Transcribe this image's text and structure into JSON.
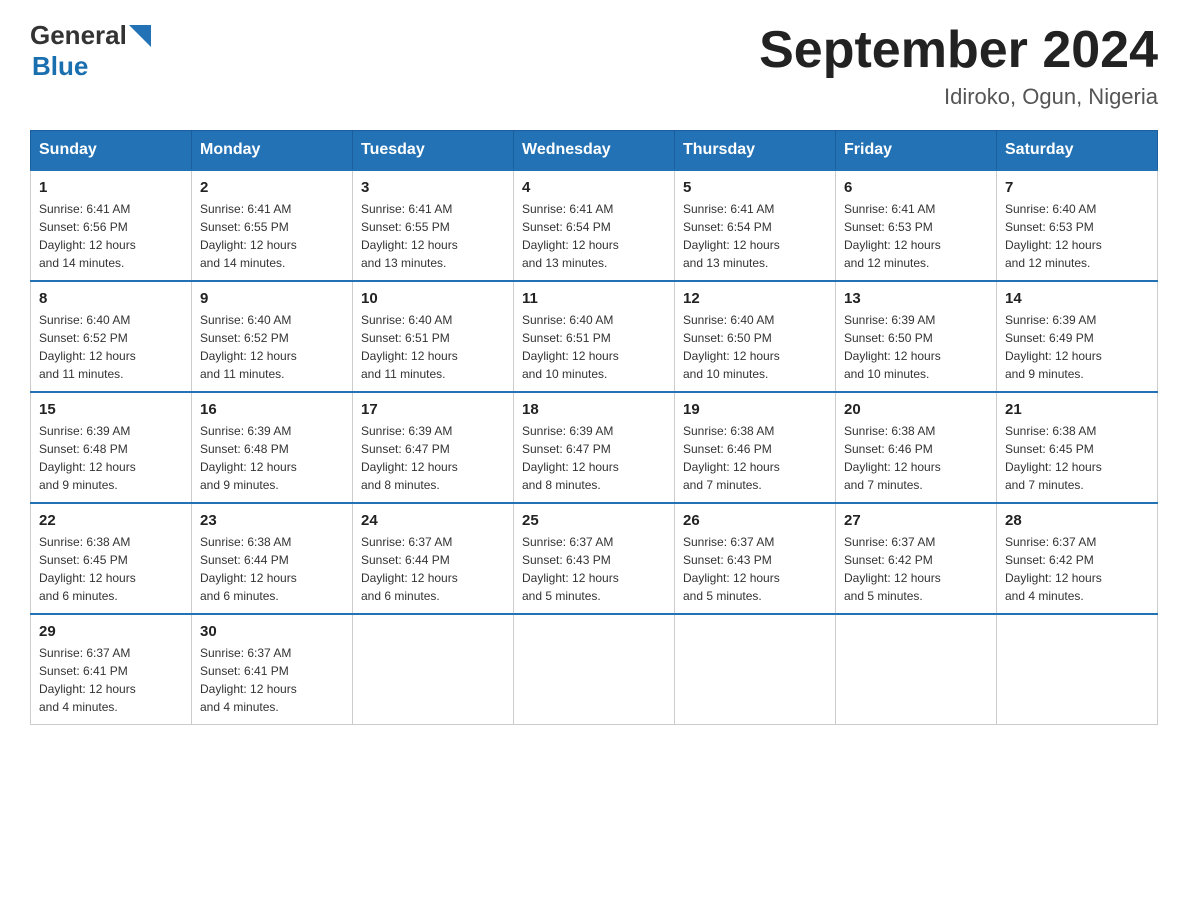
{
  "header": {
    "logo_general": "General",
    "logo_blue": "Blue",
    "title": "September 2024",
    "subtitle": "Idiroko, Ogun, Nigeria"
  },
  "days_of_week": [
    "Sunday",
    "Monday",
    "Tuesday",
    "Wednesday",
    "Thursday",
    "Friday",
    "Saturday"
  ],
  "weeks": [
    [
      {
        "day": "1",
        "sunrise": "6:41 AM",
        "sunset": "6:56 PM",
        "daylight": "12 hours and 14 minutes."
      },
      {
        "day": "2",
        "sunrise": "6:41 AM",
        "sunset": "6:55 PM",
        "daylight": "12 hours and 14 minutes."
      },
      {
        "day": "3",
        "sunrise": "6:41 AM",
        "sunset": "6:55 PM",
        "daylight": "12 hours and 13 minutes."
      },
      {
        "day": "4",
        "sunrise": "6:41 AM",
        "sunset": "6:54 PM",
        "daylight": "12 hours and 13 minutes."
      },
      {
        "day": "5",
        "sunrise": "6:41 AM",
        "sunset": "6:54 PM",
        "daylight": "12 hours and 13 minutes."
      },
      {
        "day": "6",
        "sunrise": "6:41 AM",
        "sunset": "6:53 PM",
        "daylight": "12 hours and 12 minutes."
      },
      {
        "day": "7",
        "sunrise": "6:40 AM",
        "sunset": "6:53 PM",
        "daylight": "12 hours and 12 minutes."
      }
    ],
    [
      {
        "day": "8",
        "sunrise": "6:40 AM",
        "sunset": "6:52 PM",
        "daylight": "12 hours and 11 minutes."
      },
      {
        "day": "9",
        "sunrise": "6:40 AM",
        "sunset": "6:52 PM",
        "daylight": "12 hours and 11 minutes."
      },
      {
        "day": "10",
        "sunrise": "6:40 AM",
        "sunset": "6:51 PM",
        "daylight": "12 hours and 11 minutes."
      },
      {
        "day": "11",
        "sunrise": "6:40 AM",
        "sunset": "6:51 PM",
        "daylight": "12 hours and 10 minutes."
      },
      {
        "day": "12",
        "sunrise": "6:40 AM",
        "sunset": "6:50 PM",
        "daylight": "12 hours and 10 minutes."
      },
      {
        "day": "13",
        "sunrise": "6:39 AM",
        "sunset": "6:50 PM",
        "daylight": "12 hours and 10 minutes."
      },
      {
        "day": "14",
        "sunrise": "6:39 AM",
        "sunset": "6:49 PM",
        "daylight": "12 hours and 9 minutes."
      }
    ],
    [
      {
        "day": "15",
        "sunrise": "6:39 AM",
        "sunset": "6:48 PM",
        "daylight": "12 hours and 9 minutes."
      },
      {
        "day": "16",
        "sunrise": "6:39 AM",
        "sunset": "6:48 PM",
        "daylight": "12 hours and 9 minutes."
      },
      {
        "day": "17",
        "sunrise": "6:39 AM",
        "sunset": "6:47 PM",
        "daylight": "12 hours and 8 minutes."
      },
      {
        "day": "18",
        "sunrise": "6:39 AM",
        "sunset": "6:47 PM",
        "daylight": "12 hours and 8 minutes."
      },
      {
        "day": "19",
        "sunrise": "6:38 AM",
        "sunset": "6:46 PM",
        "daylight": "12 hours and 7 minutes."
      },
      {
        "day": "20",
        "sunrise": "6:38 AM",
        "sunset": "6:46 PM",
        "daylight": "12 hours and 7 minutes."
      },
      {
        "day": "21",
        "sunrise": "6:38 AM",
        "sunset": "6:45 PM",
        "daylight": "12 hours and 7 minutes."
      }
    ],
    [
      {
        "day": "22",
        "sunrise": "6:38 AM",
        "sunset": "6:45 PM",
        "daylight": "12 hours and 6 minutes."
      },
      {
        "day": "23",
        "sunrise": "6:38 AM",
        "sunset": "6:44 PM",
        "daylight": "12 hours and 6 minutes."
      },
      {
        "day": "24",
        "sunrise": "6:37 AM",
        "sunset": "6:44 PM",
        "daylight": "12 hours and 6 minutes."
      },
      {
        "day": "25",
        "sunrise": "6:37 AM",
        "sunset": "6:43 PM",
        "daylight": "12 hours and 5 minutes."
      },
      {
        "day": "26",
        "sunrise": "6:37 AM",
        "sunset": "6:43 PM",
        "daylight": "12 hours and 5 minutes."
      },
      {
        "day": "27",
        "sunrise": "6:37 AM",
        "sunset": "6:42 PM",
        "daylight": "12 hours and 5 minutes."
      },
      {
        "day": "28",
        "sunrise": "6:37 AM",
        "sunset": "6:42 PM",
        "daylight": "12 hours and 4 minutes."
      }
    ],
    [
      {
        "day": "29",
        "sunrise": "6:37 AM",
        "sunset": "6:41 PM",
        "daylight": "12 hours and 4 minutes."
      },
      {
        "day": "30",
        "sunrise": "6:37 AM",
        "sunset": "6:41 PM",
        "daylight": "12 hours and 4 minutes."
      },
      null,
      null,
      null,
      null,
      null
    ]
  ],
  "labels": {
    "sunrise": "Sunrise:",
    "sunset": "Sunset:",
    "daylight": "Daylight:"
  }
}
